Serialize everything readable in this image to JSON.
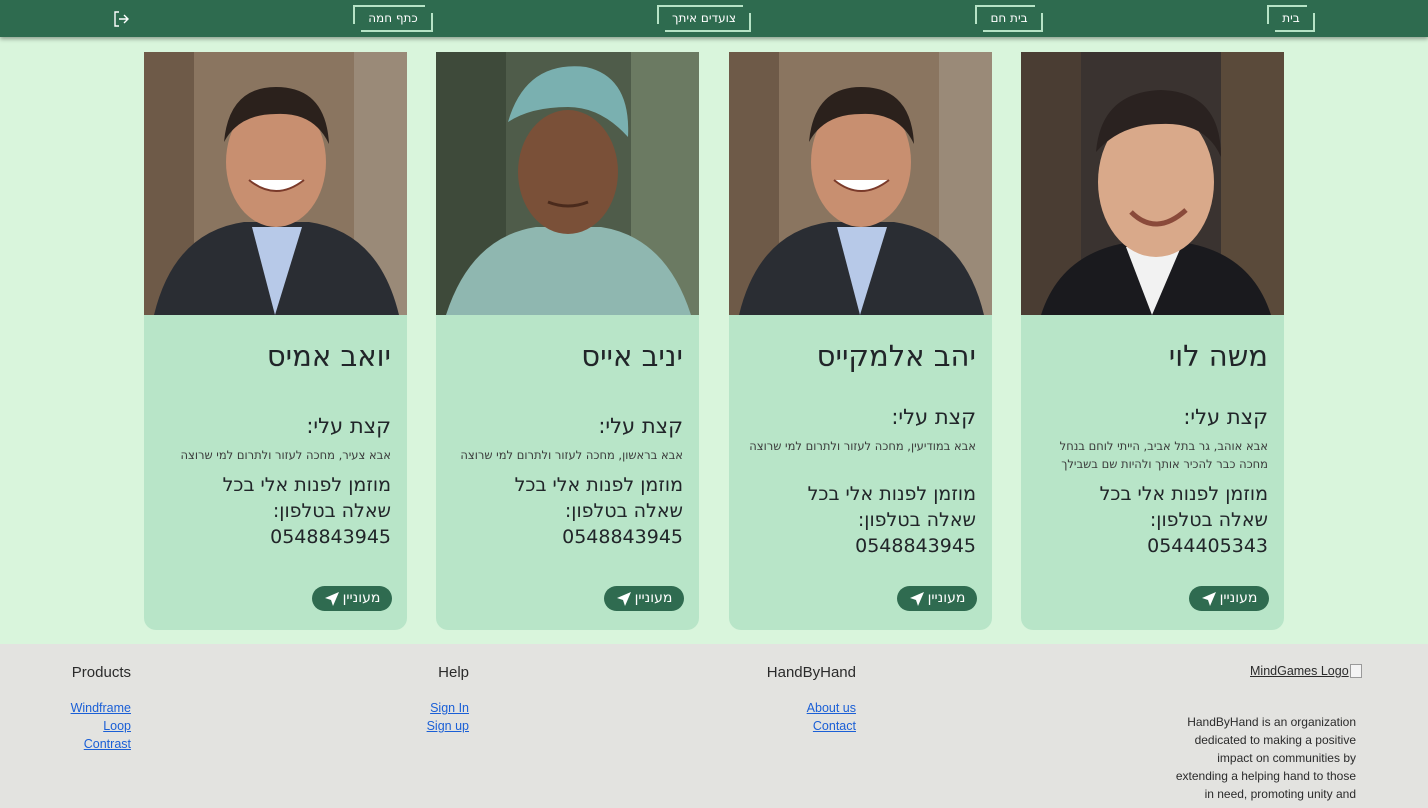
{
  "nav": {
    "items": [
      {
        "label": "בית"
      },
      {
        "label": "בית חם"
      },
      {
        "label": "צועדים איתך"
      },
      {
        "label": "כתף חמה"
      }
    ],
    "logout_icon": "logout-icon"
  },
  "cards": [
    {
      "name": "משה לוי",
      "about_title": "קצת עלי:",
      "about_text": "אבא אוהב, גר בתל אביב, הייתי לוחם בנחל מחכה כבר להכיר אותך ולהיות שם בשבילך",
      "contact_line1": "מוזמן לפנות אלי בכל",
      "contact_line2": "שאלה בטלפון:",
      "phone": "0544405343",
      "button_label": "מעוניין",
      "photo": "portrait-man-dark-hair-suit"
    },
    {
      "name": "יהב אלמקייס",
      "about_title": "קצת עלי:",
      "about_text": "אבא במודיעין, מחכה לעזור ולתרום למי שרוצה",
      "contact_line1": "מוזמן לפנות אלי בכל",
      "contact_line2": "שאלה בטלפון:",
      "phone": "0548843945",
      "button_label": "מעוניין",
      "photo": "portrait-smiling-man-suit"
    },
    {
      "name": "יניב אייס",
      "about_title": "קצת עלי:",
      "about_text": "אבא בראשון, מחכה לעזור ולתרום למי שרוצה",
      "contact_line1": "מוזמן לפנות אלי בכל",
      "contact_line2": "שאלה בטלפון:",
      "phone": "0548843945",
      "button_label": "מעוניין",
      "photo": "portrait-young-man-cap"
    },
    {
      "name": "יואב אמיס",
      "about_title": "קצת עלי:",
      "about_text": "אבא צעיר, מחכה לעזור ולתרום למי שרוצה",
      "contact_line1": "מוזמן לפנות אלי בכל",
      "contact_line2": "שאלה בטלפון:",
      "phone": "0548843945",
      "button_label": "מעוניין",
      "photo": "portrait-smiling-man-suit"
    }
  ],
  "footer": {
    "logo_alt": "MindGames Logo",
    "description": "HandByHand is an organization dedicated to making a positive impact on communities by extending a helping hand to those in need, promoting unity and",
    "columns": [
      {
        "title": "HandByHand",
        "links": [
          "About us",
          "Contact"
        ]
      },
      {
        "title": "Help",
        "links": [
          "Sign In",
          "Sign up"
        ]
      },
      {
        "title": "Products",
        "links": [
          "Windframe",
          "Loop",
          "Contrast"
        ]
      }
    ]
  },
  "colors": {
    "header": "#2e6b4f",
    "page_bg": "#d9f5dc",
    "card_bg": "#b8e5c8",
    "button_bg": "#2f6b50",
    "footer_bg": "#e3e3e0",
    "link": "#1a5fd6"
  }
}
